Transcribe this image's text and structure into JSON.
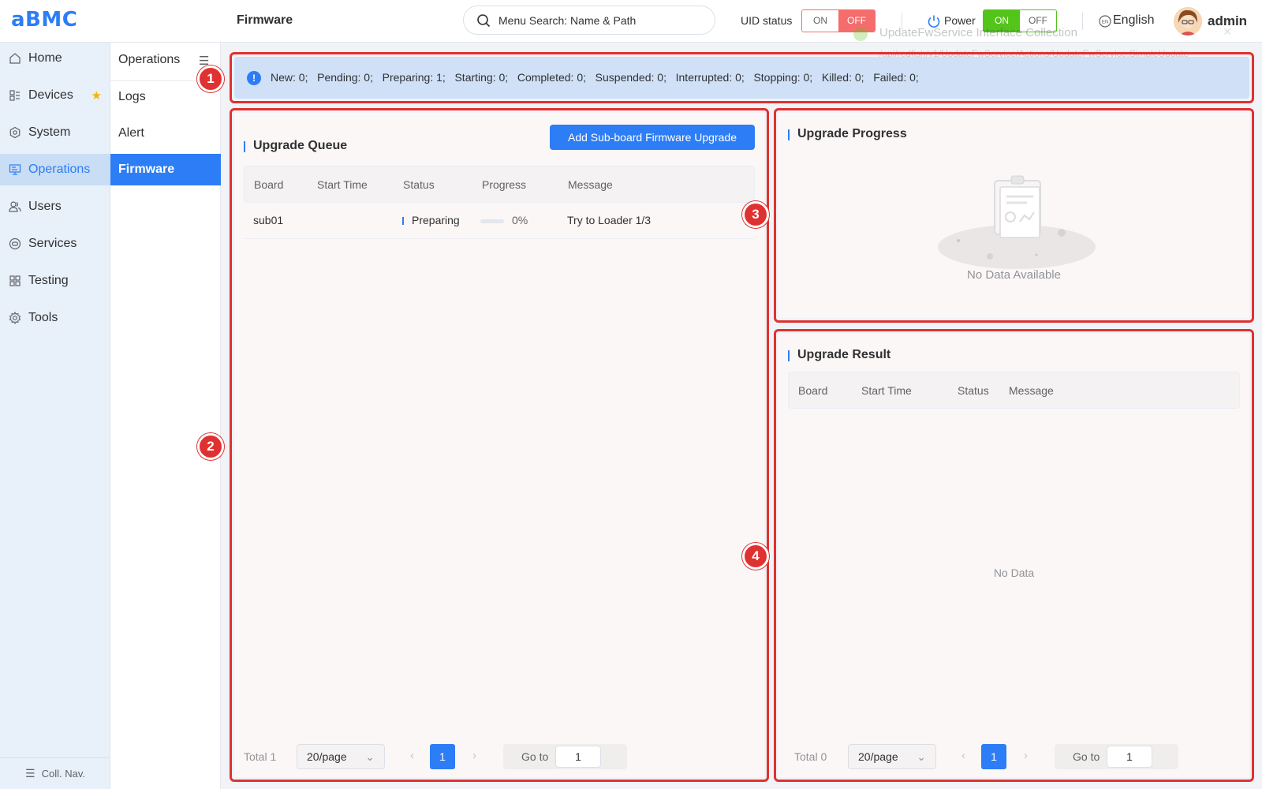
{
  "header": {
    "logo": "aBMC",
    "page_title": "Firmware",
    "search_placeholder": "Menu Search: Name & Path",
    "uid_label": "UID status",
    "uid_on": "ON",
    "uid_off": "OFF",
    "power_label": "Power",
    "power_on": "ON",
    "power_off": "OFF",
    "language": "English",
    "language_badge": "EN",
    "user": "admin"
  },
  "toast": {
    "title": "UpdateFwService Interface Collection",
    "path": "/api/redfish/v1/UpdateFwService/Actions/UpdateFwService.SimpleUpdate",
    "route": "operation/firmUpgrade"
  },
  "sidebar": {
    "items": [
      {
        "label": "Home",
        "icon": "home-icon"
      },
      {
        "label": "Devices",
        "icon": "devices-icon"
      },
      {
        "label": "System",
        "icon": "system-icon"
      },
      {
        "label": "Operations",
        "icon": "operations-icon"
      },
      {
        "label": "Users",
        "icon": "users-icon"
      },
      {
        "label": "Services",
        "icon": "services-icon"
      },
      {
        "label": "Testing",
        "icon": "testing-icon"
      },
      {
        "label": "Tools",
        "icon": "tools-icon"
      }
    ],
    "collapse_label": "Coll. Nav."
  },
  "subnav": {
    "title": "Operations",
    "items": [
      "Logs",
      "Alert",
      "Firmware"
    ]
  },
  "alert": {
    "text": "New: 0;   Pending: 0;   Preparing: 1;   Starting: 0;   Completed: 0;   Suspended: 0;   Interrupted: 0;   Stopping: 0;   Killed: 0;   Failed: 0;"
  },
  "queue": {
    "title": "Upgrade Queue",
    "add_button": "Add Sub-board Firmware Upgrade",
    "columns": [
      "Board",
      "Start Time",
      "Status",
      "Progress",
      "Message"
    ],
    "rows": [
      {
        "board": "sub01",
        "start_time": "",
        "status": "Preparing",
        "progress": "0%",
        "message": "Try to Loader 1/3"
      }
    ],
    "pager": {
      "total": "Total 1",
      "size": "20/page",
      "page": "1",
      "goto_label": "Go to",
      "goto_value": "1"
    }
  },
  "progress": {
    "title": "Upgrade Progress",
    "empty": "No Data Available"
  },
  "result": {
    "title": "Upgrade Result",
    "columns": [
      "Board",
      "Start Time",
      "Status",
      "Message"
    ],
    "empty": "No Data",
    "pager": {
      "total": "Total 0",
      "size": "20/page",
      "page": "1",
      "goto_label": "Go to",
      "goto_value": "1"
    }
  },
  "annotations": [
    "1",
    "2",
    "3",
    "4"
  ],
  "colors": {
    "accent": "#2d7df6",
    "annotation": "#e03131",
    "uid_off": "#f56c6c",
    "power_on": "#52c41a"
  }
}
